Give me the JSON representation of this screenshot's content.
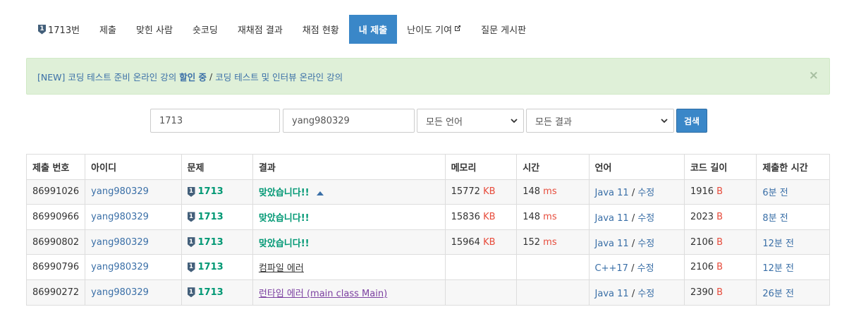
{
  "tabs": [
    {
      "label": "1713번",
      "badge": "1",
      "active": false
    },
    {
      "label": "제출",
      "active": false
    },
    {
      "label": "맞힌 사람",
      "active": false
    },
    {
      "label": "숏코딩",
      "active": false
    },
    {
      "label": "재채점 결과",
      "active": false
    },
    {
      "label": "채점 현황",
      "active": false
    },
    {
      "label": "내 제출",
      "active": true
    },
    {
      "label": "난이도 기여",
      "active": false
    },
    {
      "label": "질문 게시판",
      "active": false
    }
  ],
  "alert": {
    "prefix": "[NEW] 코딩 테스트 준비 온라인 강의 ",
    "highlight": "할인 중",
    "separator": " / ",
    "suffix": "코딩 테스트 및 인터뷰 온라인 강의",
    "close": "×"
  },
  "search": {
    "problem_id": "1713",
    "user_id": "yang980329",
    "language": "모든 언어",
    "result": "모든 결과",
    "button": "검색"
  },
  "table": {
    "headers": [
      "제출 번호",
      "아이디",
      "문제",
      "결과",
      "메모리",
      "시간",
      "언어",
      "코드 길이",
      "제출한 시간"
    ],
    "rows": [
      {
        "id": "86991026",
        "user": "yang980329",
        "badge": "1",
        "problem": "1713",
        "result": "맞았습니다!!",
        "result_type": "ac",
        "memory": "15772",
        "memory_unit": "KB",
        "time": "148",
        "time_unit": "ms",
        "lang": "Java 11",
        "edit": "수정",
        "length": "1916",
        "length_unit": "B",
        "submitted": "6분 전"
      },
      {
        "id": "86990966",
        "user": "yang980329",
        "badge": "1",
        "problem": "1713",
        "result": "맞았습니다!!",
        "result_type": "ac",
        "memory": "15836",
        "memory_unit": "KB",
        "time": "148",
        "time_unit": "ms",
        "lang": "Java 11",
        "edit": "수정",
        "length": "2023",
        "length_unit": "B",
        "submitted": "8분 전"
      },
      {
        "id": "86990802",
        "user": "yang980329",
        "badge": "1",
        "problem": "1713",
        "result": "맞았습니다!!",
        "result_type": "ac",
        "memory": "15964",
        "memory_unit": "KB",
        "time": "152",
        "time_unit": "ms",
        "lang": "Java 11",
        "edit": "수정",
        "length": "2106",
        "length_unit": "B",
        "submitted": "12분 전"
      },
      {
        "id": "86990796",
        "user": "yang980329",
        "badge": "1",
        "problem": "1713",
        "result": "컴파일 에러",
        "result_type": "ce",
        "memory": "",
        "memory_unit": "",
        "time": "",
        "time_unit": "",
        "lang": "C++17",
        "edit": "수정",
        "length": "2106",
        "length_unit": "B",
        "submitted": "12분 전"
      },
      {
        "id": "86990272",
        "user": "yang980329",
        "badge": "1",
        "problem": "1713",
        "result": "런타임 에러 (main class Main)",
        "result_type": "re",
        "memory": "",
        "memory_unit": "",
        "time": "",
        "time_unit": "",
        "lang": "Java 11",
        "edit": "수정",
        "length": "2390",
        "length_unit": "B",
        "submitted": "26분 전"
      }
    ]
  },
  "colors": {
    "accent": "#3a87c8",
    "success": "#009874",
    "alert_bg": "#dff0d8",
    "unit": "#e74c3c"
  }
}
